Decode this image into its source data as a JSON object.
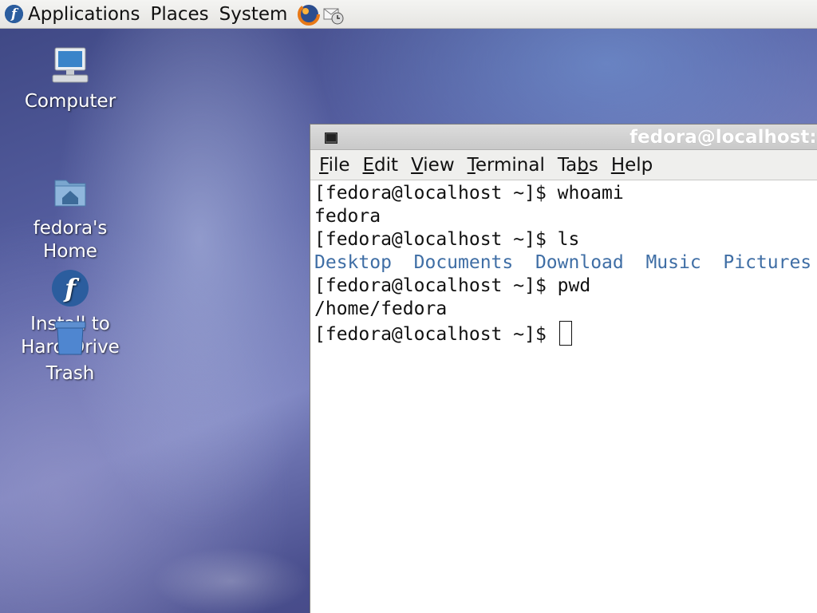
{
  "panel": {
    "menus": [
      "Applications",
      "Places",
      "System"
    ],
    "launchers": [
      "firefox-icon",
      "mail-clock-icon"
    ]
  },
  "desktop": {
    "icons": [
      {
        "label": "Computer",
        "icon": "computer-icon"
      },
      {
        "label": "fedora's\nHome",
        "icon": "home-folder-icon"
      },
      {
        "label": "Install to\nHard Drive",
        "icon": "fedora-logo-icon"
      },
      {
        "label": "Trash",
        "icon": "trash-icon"
      }
    ]
  },
  "terminal": {
    "title": "fedora@localhost:~",
    "menu": [
      "File",
      "Edit",
      "View",
      "Terminal",
      "Tabs",
      "Help"
    ],
    "prompt": "[fedora@localhost ~]$ ",
    "lines": [
      {
        "cmd": "whoami"
      },
      {
        "out": "fedora"
      },
      {
        "cmd": "ls"
      },
      {
        "dirs": [
          "Desktop",
          "Documents",
          "Download",
          "Music",
          "Pictures"
        ]
      },
      {
        "cmd": "pwd"
      },
      {
        "out": "/home/fedora"
      },
      {
        "cmd": ""
      }
    ],
    "colors": {
      "directory": "#3f6ea5"
    }
  }
}
